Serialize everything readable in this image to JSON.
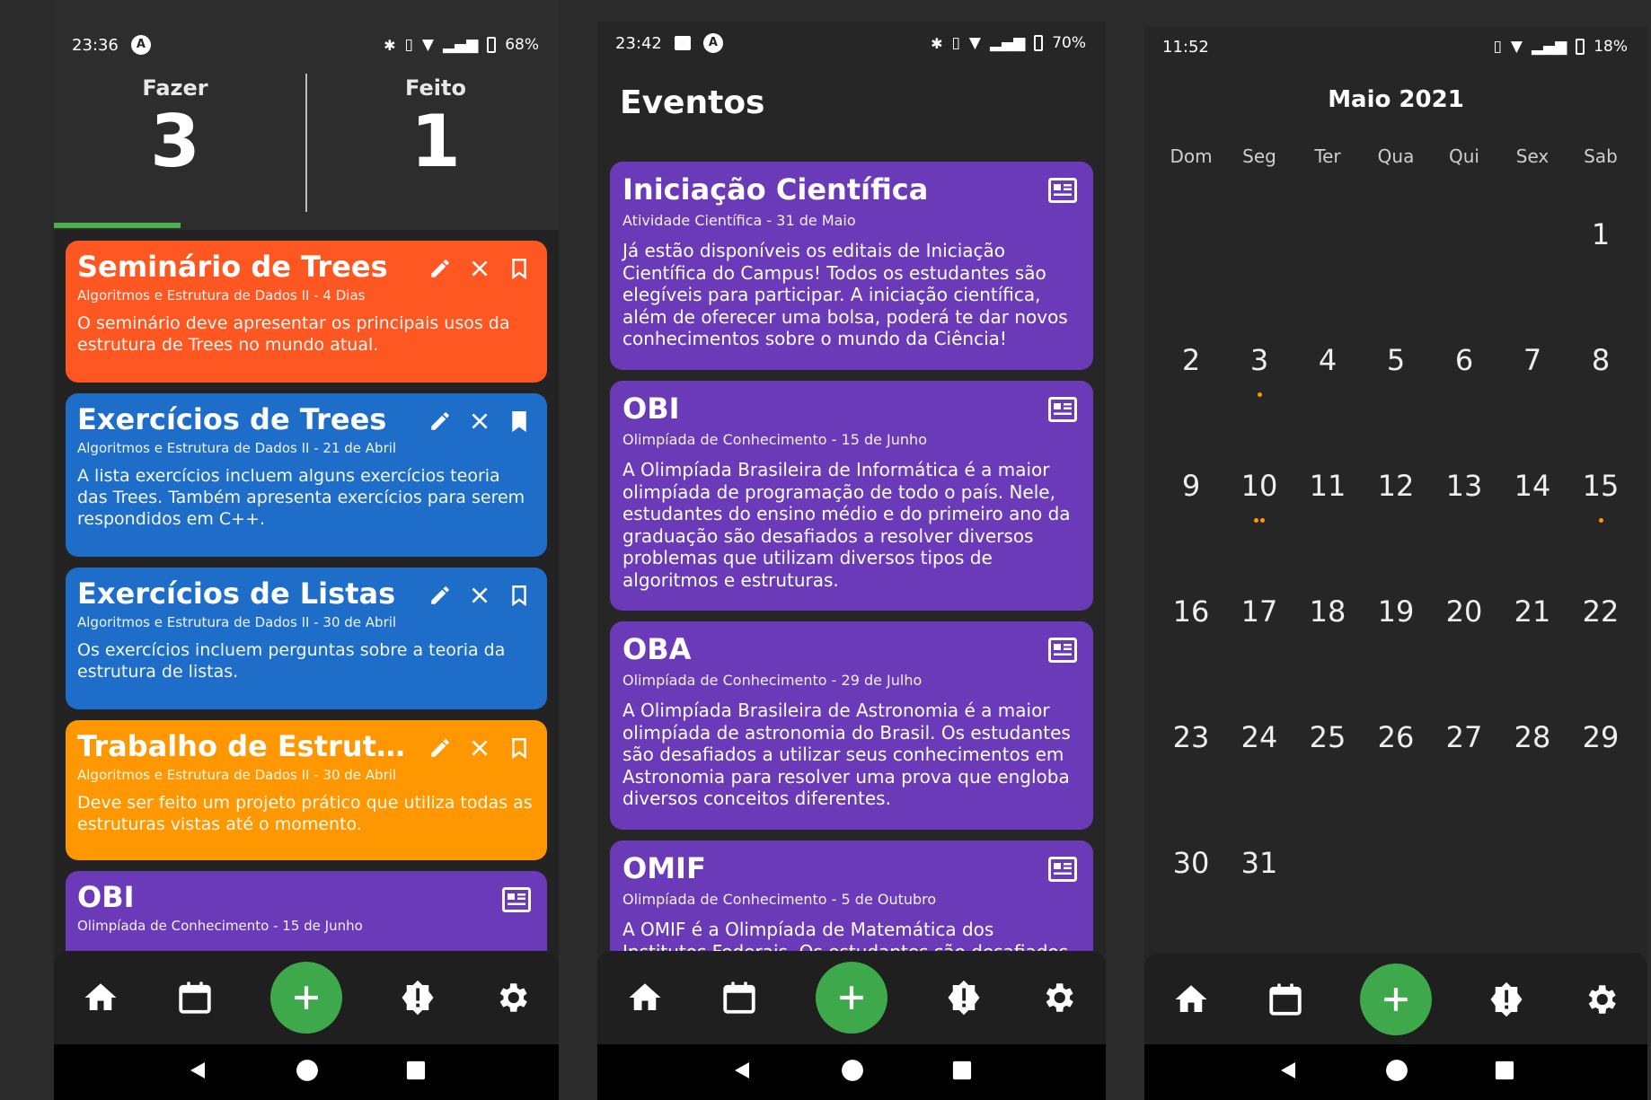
{
  "colors": {
    "orange_red": "#ff5722",
    "blue": "#1e6ec9",
    "orange": "#ff9800",
    "purple": "#6a3ab8",
    "green": "#3da94a",
    "dot": "#ff9800"
  },
  "phone1": {
    "status": {
      "time": "23:36",
      "battery": "68%"
    },
    "todo_label": "Fazer",
    "todo_count": "3",
    "done_label": "Feito",
    "done_count": "1",
    "cards": [
      {
        "title": "Seminário de Trees",
        "subtitle": "Algoritmos e Estrutura de Dados II - 4 Dias",
        "description": "O seminário deve apresentar os principais usos da estrutura de Trees no mundo atual.",
        "color": "#ff5722",
        "bookmarked": false
      },
      {
        "title": "Exercícios de Trees",
        "subtitle": "Algoritmos e Estrutura de Dados II - 21 de Abril",
        "description": "A lista exercícios incluem alguns exercícios teoria das Trees. Também apresenta exercícios para serem respondidos em C++.",
        "color": "#1e6ec9",
        "bookmarked": true
      },
      {
        "title": "Exercícios de Listas",
        "subtitle": "Algoritmos e Estrutura de Dados II - 30 de Abril",
        "description": "Os exercícios incluem perguntas sobre a teoria da estrutura de listas.",
        "color": "#1e6ec9",
        "bookmarked": false
      },
      {
        "title": "Trabalho de Estruturas...",
        "subtitle": "Algoritmos e Estrutura de Dados II - 30 de Abril",
        "description": "Deve ser feito um projeto prático que utiliza todas as estruturas vistas até o momento.",
        "color": "#ff9800",
        "bookmarked": false
      },
      {
        "title": "OBI",
        "subtitle": "Olimpíada de Conhecimento - 15 de Junho",
        "description": "",
        "color": "#6a3ab8"
      }
    ]
  },
  "phone2": {
    "status": {
      "time": "23:42",
      "battery": "70%"
    },
    "title": "Eventos",
    "events": [
      {
        "title": "Iniciação Científica",
        "subtitle": "Atividade Científica - 31 de Maio",
        "description": "Já estão disponíveis os editais de Iniciação Científica do Campus! Todos os estudantes são elegíveis para participar. A iniciação científica, além de oferecer uma bolsa, poderá te dar novos conhecimentos sobre o mundo da Ciência!"
      },
      {
        "title": "OBI",
        "subtitle": "Olimpíada de Conhecimento - 15 de Junho",
        "description": "A Olimpíada Brasileira de Informática é a maior olimpíada de programação de todo o país. Nele, estudantes do ensino médio e do primeiro ano da graduação são desafiados a resolver diversos problemas que utilizam diversos tipos de algoritmos e estruturas."
      },
      {
        "title": "OBA",
        "subtitle": "Olimpíada de Conhecimento - 29 de Julho",
        "description": "A Olimpíada Brasileira de Astronomia é a maior olimpíada de astronomia do Brasil. Os estudantes são desafiados a utilizar seus conhecimentos em Astronomia para resolver uma prova que engloba diversos conceitos diferentes."
      },
      {
        "title": "OMIF",
        "subtitle": "Olimpíada de Conhecimento - 5 de Outubro",
        "description": "A OMIF é a Olimpíada de Matemática dos Institutos Federais. Os estudantes são desafiados a utilizar"
      }
    ]
  },
  "phone3": {
    "status": {
      "time": "11:52",
      "battery": "18%"
    },
    "month": "Maio 2021",
    "weekdays": [
      "Dom",
      "Seg",
      "Ter",
      "Qua",
      "Qui",
      "Sex",
      "Sab"
    ],
    "days": [
      "",
      "",
      "",
      "",
      "",
      "",
      "1",
      "2",
      "3",
      "4",
      "5",
      "6",
      "7",
      "8",
      "9",
      "10",
      "11",
      "12",
      "13",
      "14",
      "15",
      "16",
      "17",
      "18",
      "19",
      "20",
      "21",
      "22",
      "23",
      "24",
      "25",
      "26",
      "27",
      "28",
      "29",
      "30",
      "31"
    ],
    "event_dots": {
      "3": 1,
      "10": 2,
      "15": 1
    }
  },
  "nav": {
    "icons": [
      "home-icon",
      "calendar-icon",
      "add-icon",
      "alert-icon",
      "settings-icon"
    ]
  }
}
